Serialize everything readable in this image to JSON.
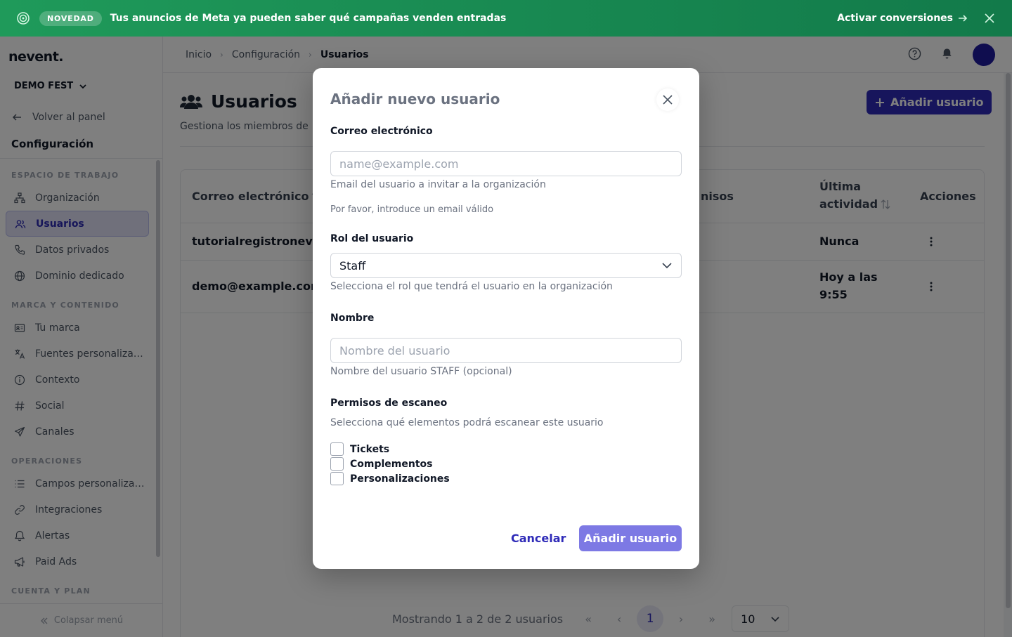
{
  "banner": {
    "badge": "NOVEDAD",
    "message": "Tus anuncios de Meta ya pueden saber qué campañas venden entradas",
    "cta": "Activar conversiones",
    "bg_color": "#1a8c52"
  },
  "sidebar": {
    "logo": "nevent.",
    "org": "DEMO FEST",
    "back": "Volver al panel",
    "section": "Configuración",
    "groups": [
      {
        "title": "ESPACIO DE TRABAJO",
        "items": [
          {
            "label": "Organización",
            "icon": "sitemap-icon"
          },
          {
            "label": "Usuarios",
            "icon": "users-icon",
            "active": true
          },
          {
            "label": "Datos privados",
            "icon": "phone-icon"
          },
          {
            "label": "Dominio dedicado",
            "icon": "globe-icon"
          }
        ]
      },
      {
        "title": "MARCA Y CONTENIDO",
        "items": [
          {
            "label": "Tu marca",
            "icon": "id-card-icon"
          },
          {
            "label": "Fuentes personalizad...",
            "icon": "translate-icon"
          },
          {
            "label": "Contexto",
            "icon": "info-icon"
          },
          {
            "label": "Social",
            "icon": "hashtag-icon"
          },
          {
            "label": "Canales",
            "icon": "send-icon"
          }
        ]
      },
      {
        "title": "OPERACIONES",
        "items": [
          {
            "label": "Campos personalizad...",
            "icon": "list-icon"
          },
          {
            "label": "Integraciones",
            "icon": "link-icon"
          },
          {
            "label": "Alertas",
            "icon": "bell-icon"
          },
          {
            "label": "Paid Ads",
            "icon": "megaphone-icon"
          }
        ]
      },
      {
        "title": "CUENTA Y PLAN",
        "items": []
      }
    ],
    "collapse": "Colapsar menú"
  },
  "breadcrumb": [
    "Inicio",
    "Configuración",
    "Usuarios"
  ],
  "page": {
    "title": "Usuarios",
    "subtitle": "Gestiona los miembros de",
    "add_button": "Añadir usuario"
  },
  "table": {
    "headers": {
      "email": "Correo electrónico",
      "perms": "nisos",
      "last_activity_1": "Última",
      "last_activity_2": "actividad",
      "actions": "Acciones"
    },
    "rows": [
      {
        "email": "tutorialregistroneven",
        "last_1": "Nunca",
        "last_2": ""
      },
      {
        "email": "demo@example.com",
        "last_1": "Hoy a las",
        "last_2": "9:55"
      }
    ]
  },
  "pagination": {
    "info": "Mostrando 1 a 2 de 2 usuarios",
    "current": "1",
    "page_size": "10"
  },
  "modal": {
    "title": "Añadir nuevo usuario",
    "email_label": "Correo electrónico",
    "email_placeholder": "name@example.com",
    "email_help": "Email del usuario a invitar a la organización",
    "email_error": "Por favor, introduce un email válido",
    "role_label": "Rol del usuario",
    "role_value": "Staff",
    "role_help": "Selecciona el rol que tendrá el usuario en la organización",
    "name_label": "Nombre",
    "name_placeholder": "Nombre del usuario",
    "name_help": "Nombre del usuario STAFF (opcional)",
    "perms_label": "Permisos de escaneo",
    "perms_help": "Selecciona qué elementos podrá escanear este usuario",
    "perms": [
      "Tickets",
      "Complementos",
      "Personalizaciones"
    ],
    "cancel": "Cancelar",
    "submit": "Añadir usuario"
  },
  "colors": {
    "accent": "#2f2bb8",
    "submit_disabled": "#7d79e4",
    "banner_green": "#1a8c52"
  }
}
